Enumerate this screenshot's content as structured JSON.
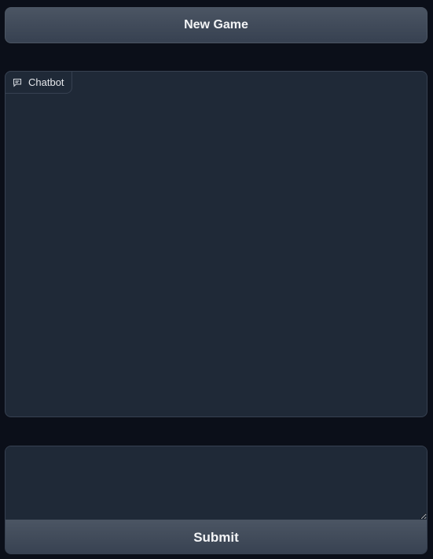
{
  "new_game_button": {
    "label": "New Game"
  },
  "chatbot": {
    "label": "Chatbot",
    "icon": "chat-bubble-icon",
    "messages": []
  },
  "message_input": {
    "value": "",
    "placeholder": ""
  },
  "submit_button": {
    "label": "Submit"
  },
  "colors": {
    "background": "#0b0f19",
    "panel": "#1f2937",
    "border": "#374151",
    "button": "#4b5563",
    "text": "#f3f4f6"
  }
}
